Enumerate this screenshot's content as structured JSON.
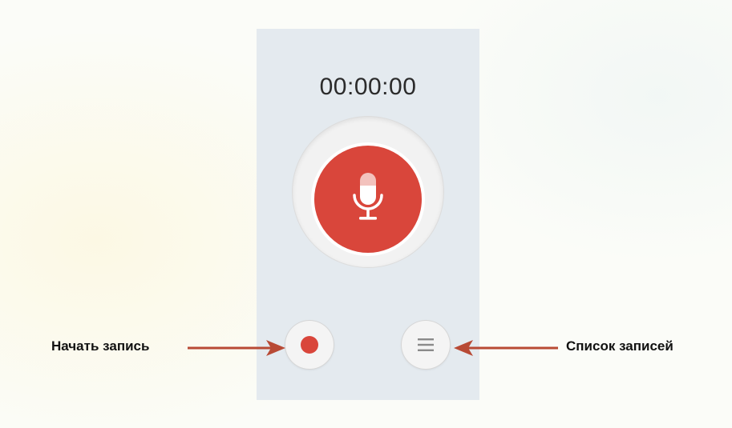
{
  "recorder": {
    "timer": "00:00:00"
  },
  "annotations": {
    "start_recording": "Начать запись",
    "recordings_list": "Список записей"
  },
  "icons": {
    "main": "microphone-icon",
    "record": "record-dot-icon",
    "list": "list-icon"
  },
  "colors": {
    "accent": "#d9463b",
    "arrow": "#b84a35",
    "panel": "#e4eaef"
  }
}
